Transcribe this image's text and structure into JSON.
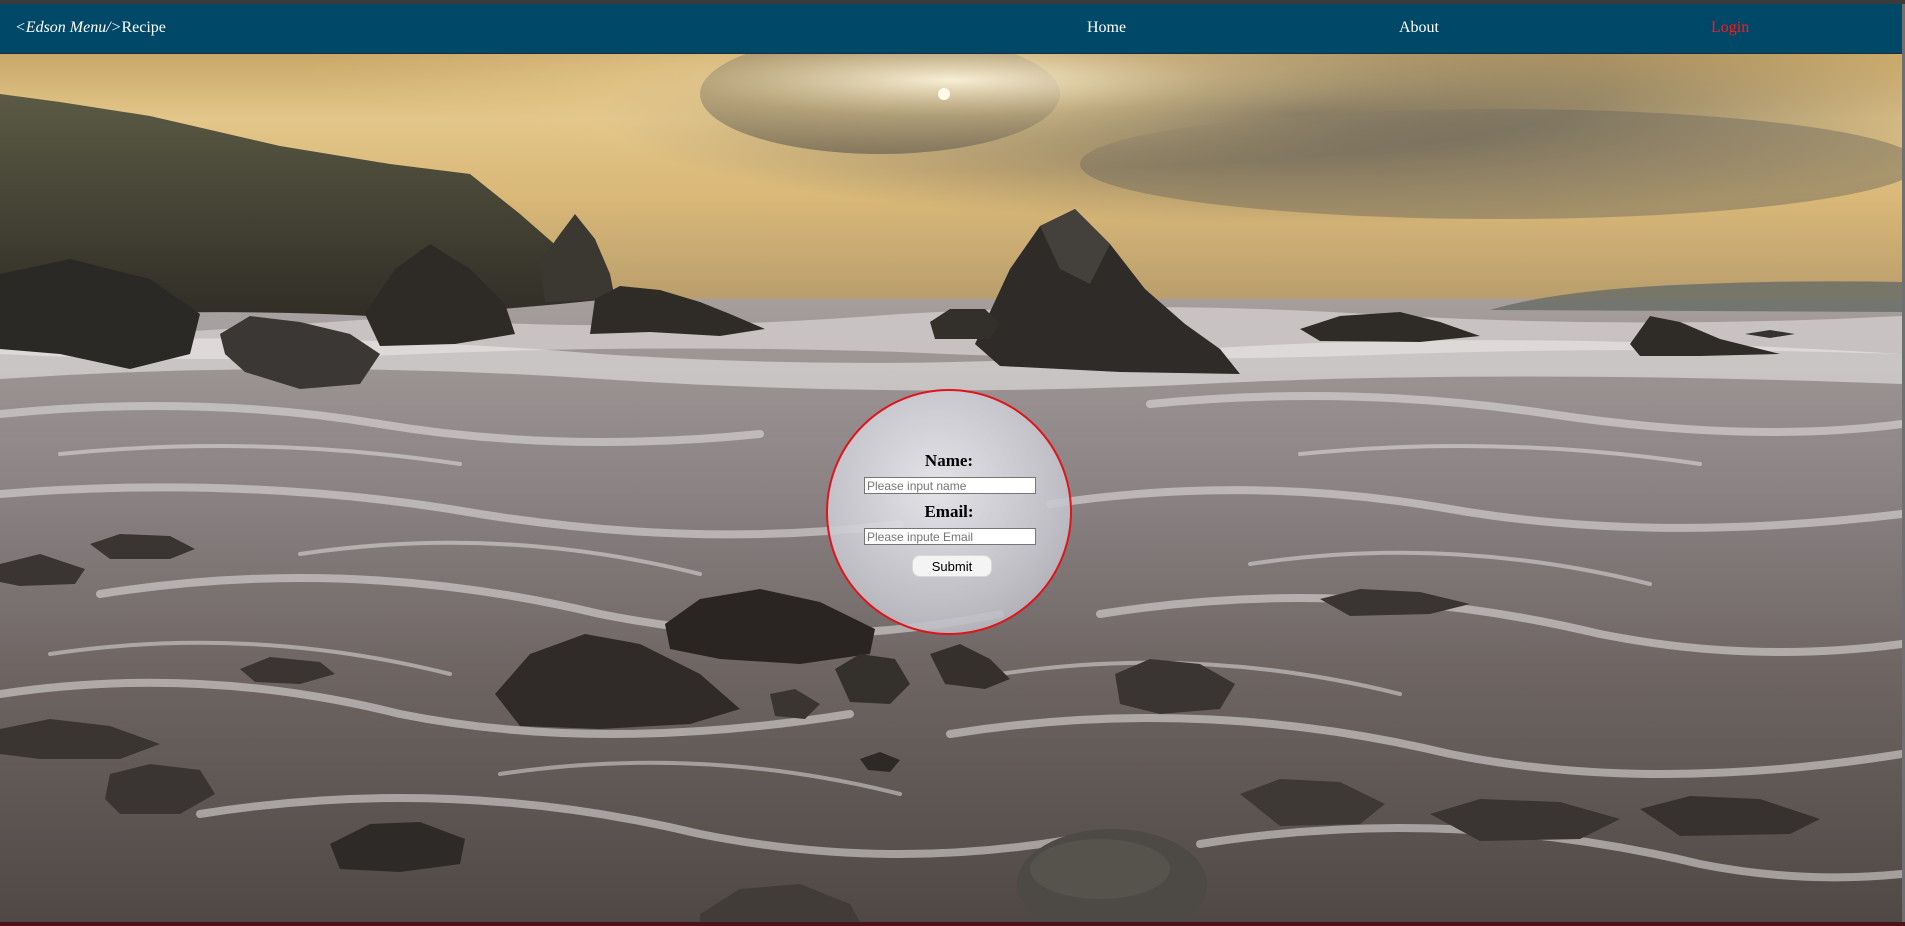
{
  "navbar": {
    "brand_italic": "<Edson Menu/>",
    "brand_text": "Recipe",
    "links": [
      {
        "label": "Home"
      },
      {
        "label": "About"
      },
      {
        "label": "Login",
        "color": "#ff1a1a"
      }
    ],
    "background": "#004868"
  },
  "hero": {
    "image": "seascape-sunset-rocks-waves"
  },
  "form": {
    "name_label": "Name:",
    "name_placeholder": "Please input name",
    "email_label": "Email:",
    "email_placeholder": "Please inpute Email",
    "submit_label": "Submit",
    "border_color": "#e0141c"
  }
}
